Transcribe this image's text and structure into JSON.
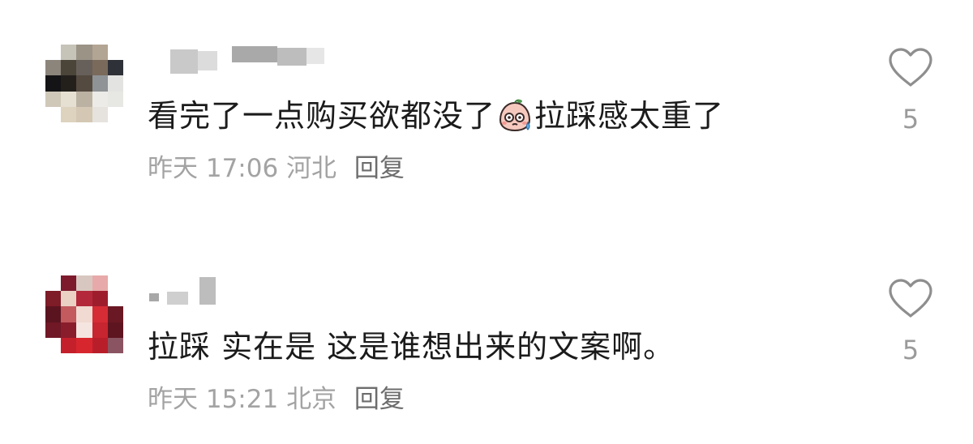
{
  "comments": [
    {
      "avatar_colors": [
        "#ffffff",
        "#c6c3b8",
        "#9a9386",
        "#b3a593",
        "#ffffff",
        "#8b857c",
        "#4a4538",
        "#67605a",
        "#7a6a5b",
        "#2e3138",
        "#141416",
        "#23201c",
        "#544a40",
        "#8f9396",
        "#e3e3e1",
        "#cfc8b9",
        "#e6e0d3",
        "#bcb2a4",
        "#ecebe8",
        "#e7e7e4",
        "#ffffff",
        "#ddd3bf",
        "#d4c8b4",
        "#e6e3de",
        "#ffffff"
      ],
      "username_blocks": [
        "#c9c9c9",
        "#dcdcdc",
        "#a9a9a9",
        "#bdbdbd",
        "#e6e6e6"
      ],
      "text_before_emoji": "看完了一点购买欲都没了",
      "emoji": "sweating-face-emoji",
      "text_after_emoji": "拉踩感太重了",
      "time": "昨天 17:06",
      "location": "河北",
      "reply_label": "回复",
      "like_count": "5"
    },
    {
      "avatar_colors": [
        "#ffffff",
        "#7d1a2c",
        "#d8c7c0",
        "#e7a9a9",
        "#ffffff",
        "#7e1c28",
        "#ead1c4",
        "#b3283a",
        "#9e1d2d",
        "#ffffff",
        "#5a1420",
        "#c25a5e",
        "#f0dad2",
        "#d62c36",
        "#6a1823",
        "#701826",
        "#8a1d2c",
        "#f5e5e1",
        "#c7252f",
        "#5e1520",
        "#ffffff",
        "#c4202c",
        "#d8262e",
        "#b81e2a",
        "#8a5462"
      ],
      "username_blocks": [
        "#a8a8a8",
        "#cfcfcf",
        "#bdbdbd"
      ],
      "text": "拉踩 实在是 这是谁想出来的文案啊。",
      "time": "昨天 15:21",
      "location": "北京",
      "reply_label": "回复",
      "like_count": "5"
    }
  ],
  "icons": {
    "like": "heart-outline-icon"
  },
  "colors": {
    "text": "#1b1b1b",
    "meta": "#a3a3a3",
    "reply": "#6d6d6d",
    "like_icon": "#8e8e8e"
  }
}
